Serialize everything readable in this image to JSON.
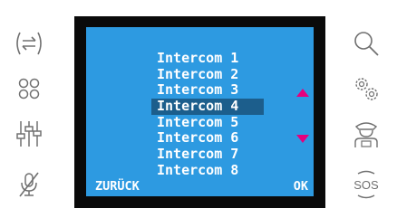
{
  "menu": {
    "items": [
      {
        "label": "Intercom 1"
      },
      {
        "label": "Intercom 2"
      },
      {
        "label": "Intercom 3"
      },
      {
        "label": "Intercom 4"
      },
      {
        "label": "Intercom 5"
      },
      {
        "label": "Intercom 6"
      },
      {
        "label": "Intercom 7"
      },
      {
        "label": "Intercom 8"
      }
    ],
    "selected_index": 3
  },
  "softkeys": {
    "left_label": "ZURÜCK",
    "right_label": "OK"
  },
  "left_buttons": [
    {
      "icon": "intercom-transfer-icon"
    },
    {
      "icon": "settings-dots-icon"
    },
    {
      "icon": "equalizer-icon"
    },
    {
      "icon": "mute-mic-icon"
    }
  ],
  "right_buttons": [
    {
      "icon": "search-icon"
    },
    {
      "icon": "gears-icon"
    },
    {
      "icon": "concierge-icon"
    },
    {
      "icon": "sos-icon",
      "label": "SOS"
    }
  ],
  "colors": {
    "screen_bg": "#2d9ae1",
    "highlight": "#1c5e8c",
    "arrow": "#e5007d",
    "frame": "#0a0a0a",
    "icon": "#707070"
  }
}
